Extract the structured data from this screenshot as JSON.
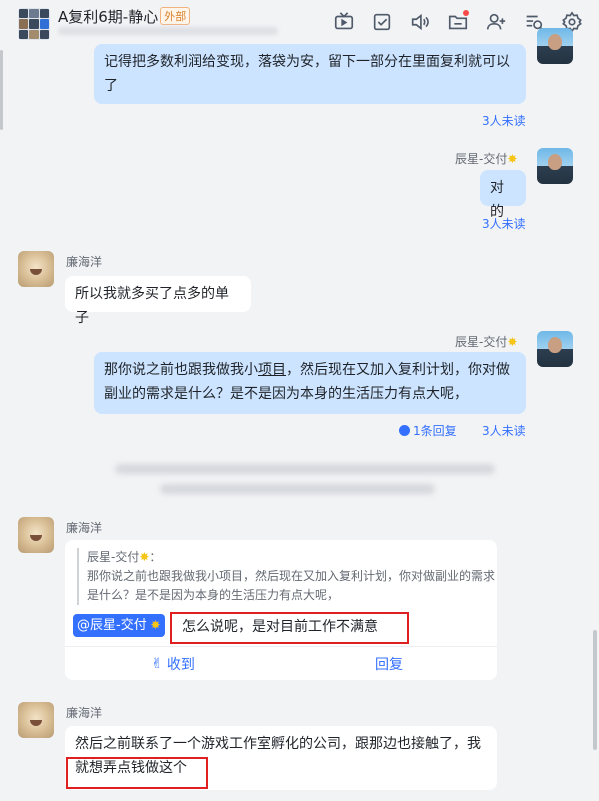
{
  "header": {
    "title": "A复利6期-静心",
    "external_tag": "外部"
  },
  "icons": [
    "tv-icon",
    "task-check-icon",
    "speaker-icon",
    "folder-icon",
    "add-member-icon",
    "search-list-icon",
    "settings-icon"
  ],
  "messages": {
    "m1_text": "记得把多数利润给变现，落袋为安，留下一部分在里面复利就可以了",
    "m1_unread": "3人未读",
    "m2_sender": "辰星-交付",
    "m2_text": "对的",
    "m2_unread": "3人未读",
    "m3_sender": "廉海洋",
    "m3_text": "所以我就多买了点多的单子",
    "m4_sender": "辰星-交付",
    "m4_text_a": "那你说之前也跟我做我小",
    "m4_text_u": "项目",
    "m4_text_b": "，然后现在又加入复利计划，你对做副业的需求是什么？是不是因为本身的生活压力有点大呢，",
    "m4_reply": "1条回复",
    "m4_unread": "3人未读",
    "m5_sender": "廉海洋",
    "m5_quote_name": "辰星-交付",
    "m5_quote_text": "那你说之前也跟我做我小项目，然后现在又加入复利计划，你对做副业的需求是什么？是不是因为本身的生活压力有点大呢，",
    "m5_mention": "@辰星-交付",
    "m5_text": "怎么说呢，是对目前工作不满意",
    "m5_btn_received": "收到",
    "m5_btn_reply": "回复",
    "m6_sender": "廉海洋",
    "m6_text": "然后之前联系了一个游戏工作室孵化的公司，跟那边也接触了，我就想弄点钱做这个"
  },
  "colors": {
    "accent": "#3370ff",
    "mine_bubble": "#cce4ff",
    "highlight_box": "#e02020"
  }
}
